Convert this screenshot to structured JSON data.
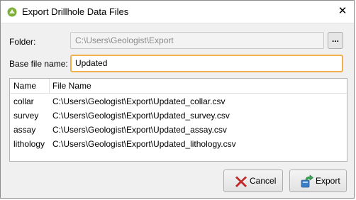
{
  "window": {
    "title": "Export Drillhole Data Files"
  },
  "folder": {
    "label": "Folder:",
    "value": "C:\\Users\\Geologist\\Export",
    "browse_label": "..."
  },
  "base_file_name": {
    "label": "Base file name:",
    "value": "Updated"
  },
  "table": {
    "headers": {
      "name": "Name",
      "file_name": "File Name"
    },
    "rows": [
      {
        "name": "collar",
        "file": "C:\\Users\\Geologist\\Export\\Updated_collar.csv"
      },
      {
        "name": "survey",
        "file": "C:\\Users\\Geologist\\Export\\Updated_survey.csv"
      },
      {
        "name": "assay",
        "file": "C:\\Users\\Geologist\\Export\\Updated_assay.csv"
      },
      {
        "name": "lithology",
        "file": "C:\\Users\\Geologist\\Export\\Updated_lithology.csv"
      }
    ]
  },
  "buttons": {
    "cancel": "Cancel",
    "export": "Export"
  },
  "icons": {
    "app": "leapfrog-app-icon",
    "close": "close-icon",
    "cancel": "cancel-x-icon",
    "export": "export-icon"
  },
  "colors": {
    "focus_border": "#f2b04c",
    "cancel_icon": "#d62b2b",
    "export_icon": "#3b7ec9"
  }
}
